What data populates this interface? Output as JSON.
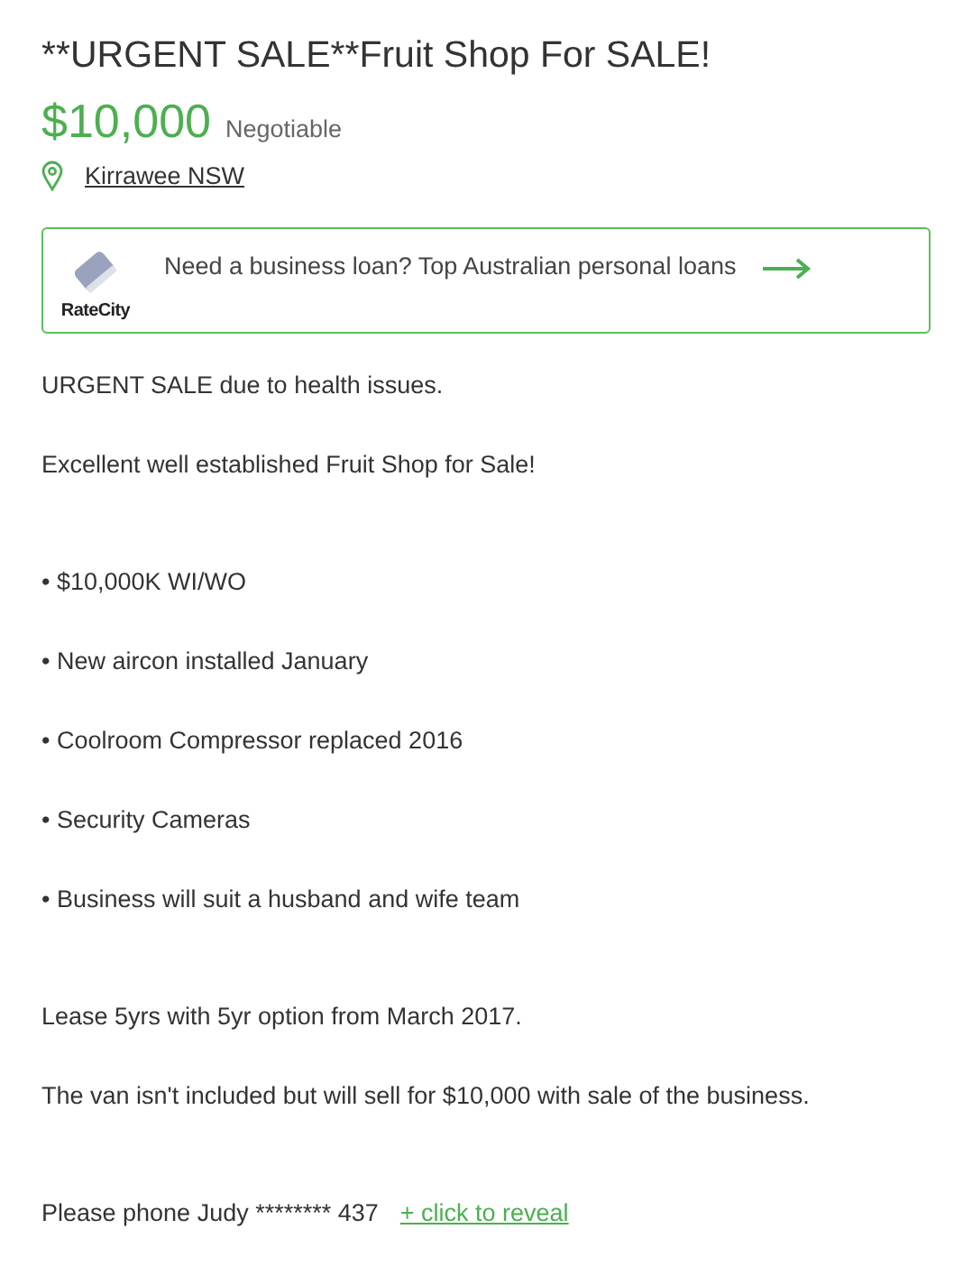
{
  "listing": {
    "title": "**URGENT SALE**Fruit Shop For SALE!",
    "price": "$10,000",
    "price_note": "Negotiable",
    "location": "Kirrawee NSW"
  },
  "ad": {
    "brand": "RateCity",
    "text": "Need a business loan? Top Australian personal loans"
  },
  "description": {
    "intro": [
      "URGENT SALE due to health issues.",
      "Excellent well established Fruit Shop for Sale!"
    ],
    "bullets": [
      "• $10,000K WI/WO",
      "• New aircon installed January",
      "• Coolroom Compressor replaced 2016",
      "• Security Cameras",
      "• Business will suit a husband and wife team"
    ],
    "closing": [
      "Lease 5yrs with 5yr option from March 2017.",
      "The van isn't included but will sell for $10,000 with sale of the business."
    ]
  },
  "contact": {
    "text": "Please phone Judy ******** 437",
    "reveal_link": "+ click to reveal"
  }
}
